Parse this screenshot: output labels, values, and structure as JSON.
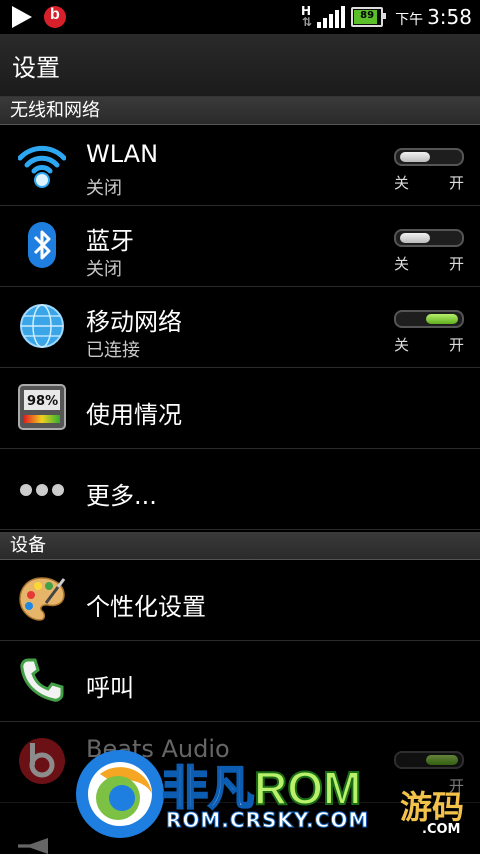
{
  "status_bar": {
    "network_type": "H",
    "battery_level": "89",
    "time_period": "下午",
    "time": "3:58"
  },
  "header": {
    "title": "设置"
  },
  "sections": [
    {
      "label": "无线和网络"
    },
    {
      "label": "设备"
    }
  ],
  "items": {
    "wlan": {
      "label": "WLAN",
      "status": "关闭",
      "toggle_off": "关",
      "toggle_on": "开",
      "enabled": false
    },
    "bluetooth": {
      "label": "蓝牙",
      "status": "关闭",
      "toggle_off": "关",
      "toggle_on": "开",
      "enabled": false
    },
    "mobile_network": {
      "label": "移动网络",
      "status": "已连接",
      "toggle_off": "关",
      "toggle_on": "开",
      "enabled": true
    },
    "data_usage": {
      "label": "使用情况",
      "icon_text": "98%"
    },
    "more": {
      "label": "更多..."
    },
    "personalize": {
      "label": "个性化设置"
    },
    "call": {
      "label": "呼叫"
    },
    "beats_audio": {
      "label": "Beats Audio",
      "toggle_on": "开",
      "enabled": true
    }
  },
  "watermark": {
    "name_part1": "非凡",
    "name_part2": "ROM",
    "url": "ROM.CRSKY.COM",
    "extra": "游码",
    "extra_domain": ".COM"
  },
  "colors": {
    "toggle_on": "#7ed23a",
    "accent_blue": "#1e88e5",
    "beats_red": "#d8202a"
  }
}
